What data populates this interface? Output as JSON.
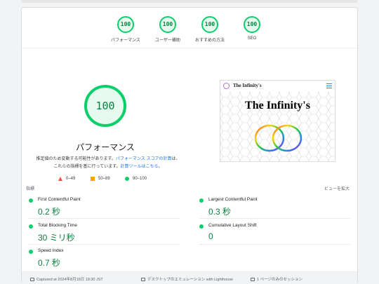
{
  "summary": [
    {
      "score": "100",
      "label": "パフォーマンス"
    },
    {
      "score": "100",
      "label": "ユーザー補助"
    },
    {
      "score": "100",
      "label": "おすすめの方法"
    },
    {
      "score": "100",
      "label": "SEO"
    }
  ],
  "performance": {
    "score": "100",
    "title": "パフォーマンス",
    "desc_part1": "推定値のため変動する可能性があります。",
    "desc_link1": "パフォーマンス スコアの計算",
    "desc_part2": "は、これらの指標を基に行っています。",
    "desc_link2": "計算ツールはこちら",
    "desc_end": "。"
  },
  "legend": {
    "fail": "0–49",
    "average": "50–89",
    "pass": "90–100"
  },
  "thumbnail": {
    "site_title": "The Infinity's",
    "headline": "The Infinity's"
  },
  "metrics_header": {
    "label": "指標",
    "expand": "ビューを拡大"
  },
  "metrics": [
    {
      "name": "First Contentful Paint",
      "value": "0.2 秒"
    },
    {
      "name": "Largest Contentful Paint",
      "value": "0.3 秒"
    },
    {
      "name": "Total Blocking Time",
      "value": "30 ミリ秒"
    },
    {
      "name": "Cumulative Layout Shift",
      "value": "0"
    },
    {
      "name": "Speed Index",
      "value": "0.7 秒"
    }
  ],
  "footer": {
    "captured": "Captured at 2024年8月16日 18:30 JST",
    "emulation": "デスクトップのエミュレーション with Lighthouse",
    "session": "1 ページのみのセッション"
  },
  "colors": {
    "pass": "#0cce6b",
    "pass_text": "#08823f",
    "average": "#ffa400",
    "fail": "#ff4e42",
    "link": "#1a73e8"
  }
}
